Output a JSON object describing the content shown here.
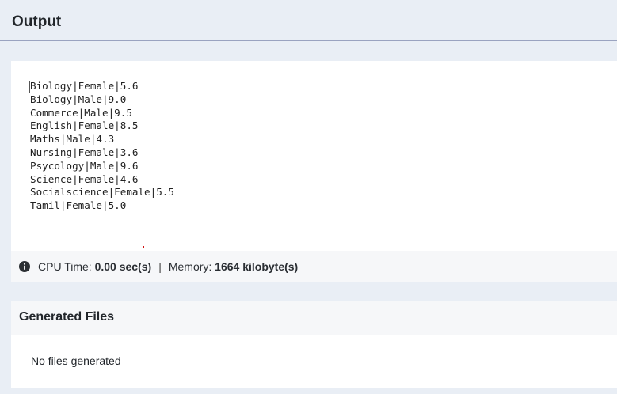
{
  "output": {
    "title": "Output",
    "lines": [
      "Biology|Female|5.6",
      "Biology|Male|9.0",
      "Commerce|Male|9.5",
      "English|Female|8.5",
      "Maths|Male|4.3",
      "Nursing|Female|3.6",
      "Psycology|Male|9.6",
      "Science|Female|4.6",
      "Socialscience|Female|5.5",
      "Tamil|Female|5.0"
    ]
  },
  "stats": {
    "icon": "info-icon",
    "cpu_label": "CPU Time:",
    "cpu_value": "0.00 sec(s)",
    "separator": "|",
    "memory_label": "Memory:",
    "memory_value": "1664 kilobyte(s)"
  },
  "generated_files": {
    "title": "Generated Files",
    "empty_message": "No files generated"
  },
  "colors": {
    "page_background": "#e9eef5",
    "panel_background": "#ffffff",
    "divider": "#9aa3c0"
  }
}
